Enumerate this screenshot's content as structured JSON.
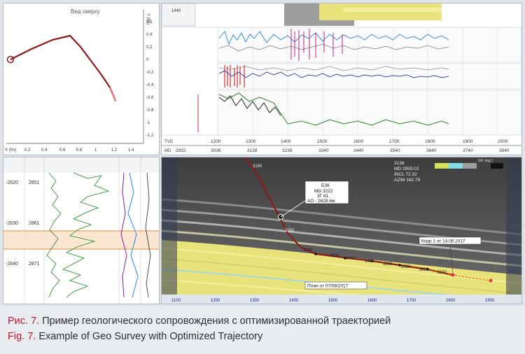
{
  "top_view": {
    "title": "Вид сверху",
    "x_axis_label": "X (fm)",
    "y_axis_label": "Y (fm)",
    "x_ticks": [
      "0.2",
      "0.4",
      "0.6",
      "0.8",
      "1",
      "1.2",
      "1.4"
    ],
    "y_ticks": [
      "0.4",
      "0.2",
      "0",
      "-0.2",
      "-0.4",
      "-0.6",
      "-0.8",
      "-1",
      "-1.2"
    ],
    "y_tick_top": "0.6"
  },
  "logs_panel": {
    "tvd_label": "TVD",
    "md_label": "MD",
    "tvd_ticks": [
      "1200",
      "1300",
      "1400",
      "1500",
      "1600",
      "1700",
      "1800",
      "1900",
      "2000"
    ],
    "md_ticks": [
      "2932",
      "3036",
      "3138",
      "3239",
      "3340",
      "3440",
      "3540",
      "3640",
      "3740",
      "3840"
    ],
    "tvd_first": "1440"
  },
  "depth_panel": {
    "depth_ticks": [
      "-2620",
      "-2630",
      "-2640"
    ],
    "md_ticks": [
      "2851",
      "2861",
      "2871"
    ]
  },
  "section": {
    "callout": [
      "БЗК",
      "MD 3222",
      "3Г 81",
      "АО - 2628.6м"
    ],
    "info_box": [
      "3138",
      "MD 2959.02",
      "INCL 72.32",
      "AZIM 162.79"
    ],
    "legend_label": "GK (ед.)",
    "correction_label": "Корр 1 от 14.06.2017",
    "plan_label": "План от 07/08/2017",
    "x_ticks": [
      "1100",
      "1200",
      "1300",
      "1400",
      "1500",
      "1600",
      "1700",
      "1800",
      "1900"
    ],
    "station_labels": [
      "3200",
      "3300",
      "3400",
      "3450",
      "3500",
      "3550",
      "3600",
      "3650"
    ],
    "upper_labels": [
      "3150",
      "3250"
    ]
  },
  "caption": {
    "ru_label": "Рис. 7.",
    "ru_text": " Пример геологического сопровождения с оптимизированной траекторией",
    "en_label": "Fig. 7.",
    "en_text": " Example of Geo Survey with Optimized Trajectory"
  },
  "colors": {
    "caption_red": "#c8102e",
    "trajectory": "#8b1a1a",
    "log_blue": "#3a8fd6",
    "log_green": "#2e7d32",
    "log_magenta": "#c2188b",
    "yellow_layer": "#e8e27a"
  }
}
